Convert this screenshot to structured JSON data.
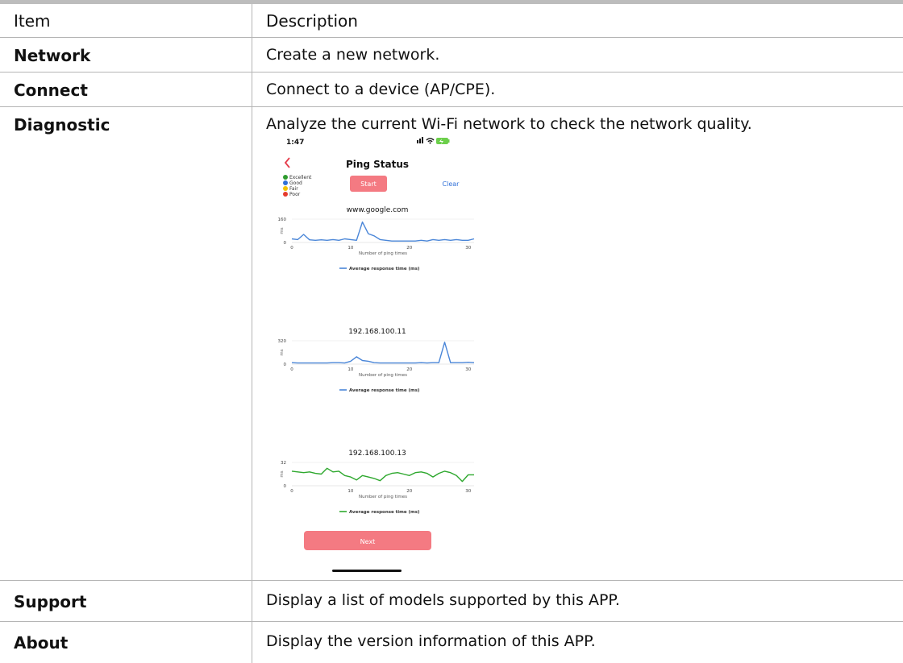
{
  "table": {
    "header": {
      "item": "Item",
      "description": "Description"
    },
    "rows": [
      {
        "item": "Network",
        "description": "Create a new network."
      },
      {
        "item": "Connect",
        "description": "Connect to a device (AP/CPE)."
      },
      {
        "item": "Diagnostic",
        "description": "Analyze the current Wi-Fi network to check the network quality."
      },
      {
        "item": "Support",
        "description": "Display a list of models supported by this APP."
      },
      {
        "item": "About",
        "description": "Display the version information of this APP."
      }
    ]
  },
  "phone": {
    "time": "1:47",
    "title": "Ping Status",
    "start_label": "Start",
    "clear_label": "Clear",
    "next_label": "Next",
    "legend": [
      {
        "label": "Excellent",
        "color": "#2e9b2e"
      },
      {
        "label": "Good",
        "color": "#2f6fd8"
      },
      {
        "label": "Fair",
        "color": "#f2c200"
      },
      {
        "label": "Poor",
        "color": "#e53b2e"
      }
    ],
    "accent": "#f47a82",
    "x_label": "Number of ping times",
    "legend_label": "Average response time (ms)"
  },
  "chart_data": [
    {
      "type": "line",
      "title": "www.google.com",
      "xlabel": "Number of ping times",
      "ylabel": "ms",
      "xlim": [
        0,
        31
      ],
      "ylim": [
        0,
        160
      ],
      "x_ticks": [
        0,
        10,
        20,
        30
      ],
      "y_ticks": [
        0,
        160
      ],
      "series": [
        {
          "name": "Average response time (ms)",
          "color": "#4a86d8",
          "values": [
            25,
            20,
            55,
            18,
            15,
            18,
            15,
            20,
            15,
            25,
            20,
            15,
            140,
            60,
            45,
            20,
            15,
            10,
            10,
            10,
            10,
            10,
            15,
            10,
            20,
            15,
            20,
            15,
            20,
            15,
            15,
            25
          ]
        }
      ]
    },
    {
      "type": "line",
      "title": "192.168.100.11",
      "xlabel": "Number of ping times",
      "ylabel": "ms",
      "xlim": [
        0,
        31
      ],
      "ylim": [
        0,
        320
      ],
      "x_ticks": [
        0,
        10,
        20,
        30
      ],
      "y_ticks": [
        0,
        320
      ],
      "series": [
        {
          "name": "Average response time (ms)",
          "color": "#4a86d8",
          "values": [
            20,
            15,
            15,
            15,
            15,
            15,
            15,
            20,
            20,
            15,
            40,
            100,
            50,
            40,
            20,
            15,
            15,
            15,
            15,
            15,
            15,
            15,
            20,
            15,
            20,
            20,
            300,
            20,
            20,
            20,
            25,
            20
          ]
        }
      ]
    },
    {
      "type": "line",
      "title": "192.168.100.13",
      "xlabel": "Number of ping times",
      "ylabel": "ms",
      "xlim": [
        0,
        31
      ],
      "ylim": [
        0,
        32
      ],
      "x_ticks": [
        0,
        10,
        20,
        30
      ],
      "y_ticks": [
        0,
        32
      ],
      "series": [
        {
          "name": "Average response time (ms)",
          "color": "#2ea82e",
          "values": [
            20,
            19,
            18,
            19,
            17,
            16,
            24,
            19,
            20,
            14,
            12,
            8,
            14,
            12,
            10,
            7,
            14,
            17,
            18,
            16,
            14,
            18,
            19,
            17,
            12,
            17,
            20,
            18,
            14,
            6,
            15,
            15
          ]
        }
      ]
    }
  ]
}
